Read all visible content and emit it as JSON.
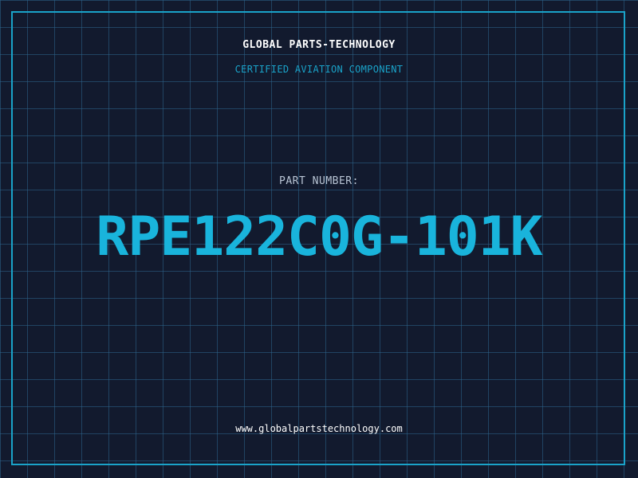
{
  "header": {
    "company_name": "GLOBAL PARTS-TECHNOLOGY",
    "tagline": "CERTIFIED AVIATION COMPONENT"
  },
  "main": {
    "part_label": "PART NUMBER:",
    "part_number": "RPE122C0G-101K"
  },
  "footer": {
    "website": "www.globalpartstechnology.com"
  },
  "colors": {
    "background": "#121a2e",
    "grid": "#2d648c",
    "accent": "#1aa3c9",
    "part_number": "#19b4dc",
    "text": "#ffffff"
  }
}
